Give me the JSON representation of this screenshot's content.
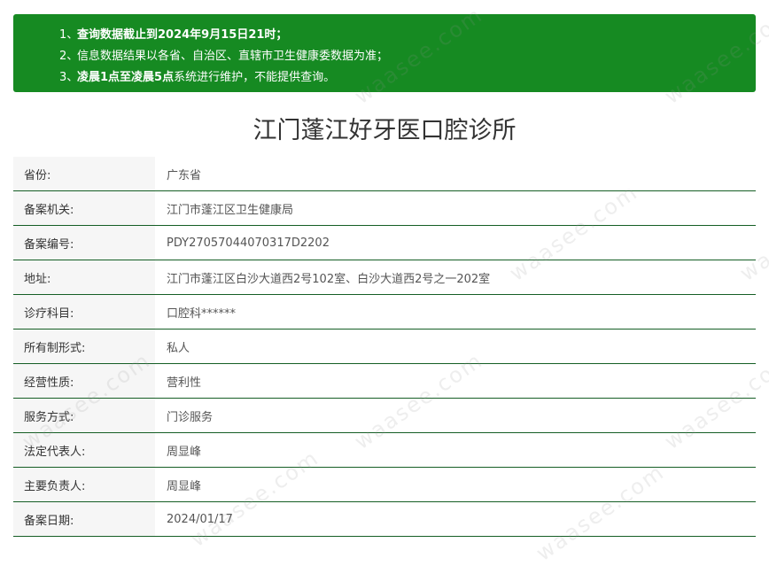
{
  "notice": {
    "lines": [
      {
        "num": "1、",
        "text": "查询数据截止到2024年9月15日21时；",
        "bold": true
      },
      {
        "num": "2、",
        "text": "信息数据结果以各省、自治区、直辖市卫生健康委数据为准；",
        "bold": false
      },
      {
        "num": "3、",
        "text_bold": "凌晨1点至凌晨5点",
        "text_rest": "系统进行维护，不能提供查询。"
      }
    ]
  },
  "title": "江门蓬江好牙医口腔诊所",
  "rows": [
    {
      "label": "省份:",
      "value": "广东省"
    },
    {
      "label": "备案机关:",
      "value": "江门市蓬江区卫生健康局"
    },
    {
      "label": "备案编号:",
      "value": "PDY27057044070317D2202"
    },
    {
      "label": "地址:",
      "value": "江门市蓬江区白沙大道西2号102室、白沙大道西2号之一202室"
    },
    {
      "label": "诊疗科目:",
      "value": "口腔科******"
    },
    {
      "label": "所有制形式:",
      "value": "私人"
    },
    {
      "label": "经营性质:",
      "value": "营利性"
    },
    {
      "label": "服务方式:",
      "value": "门诊服务"
    },
    {
      "label": "法定代表人:",
      "value": "周显峰"
    },
    {
      "label": "主要负责人:",
      "value": "周显峰"
    },
    {
      "label": "备案日期:",
      "value": "2024/01/17"
    }
  ],
  "watermark": "waasee.com",
  "colors": {
    "notice_bg": "#168a22",
    "row_divider": "#155e25",
    "label_bg": "#f6f6f6"
  }
}
